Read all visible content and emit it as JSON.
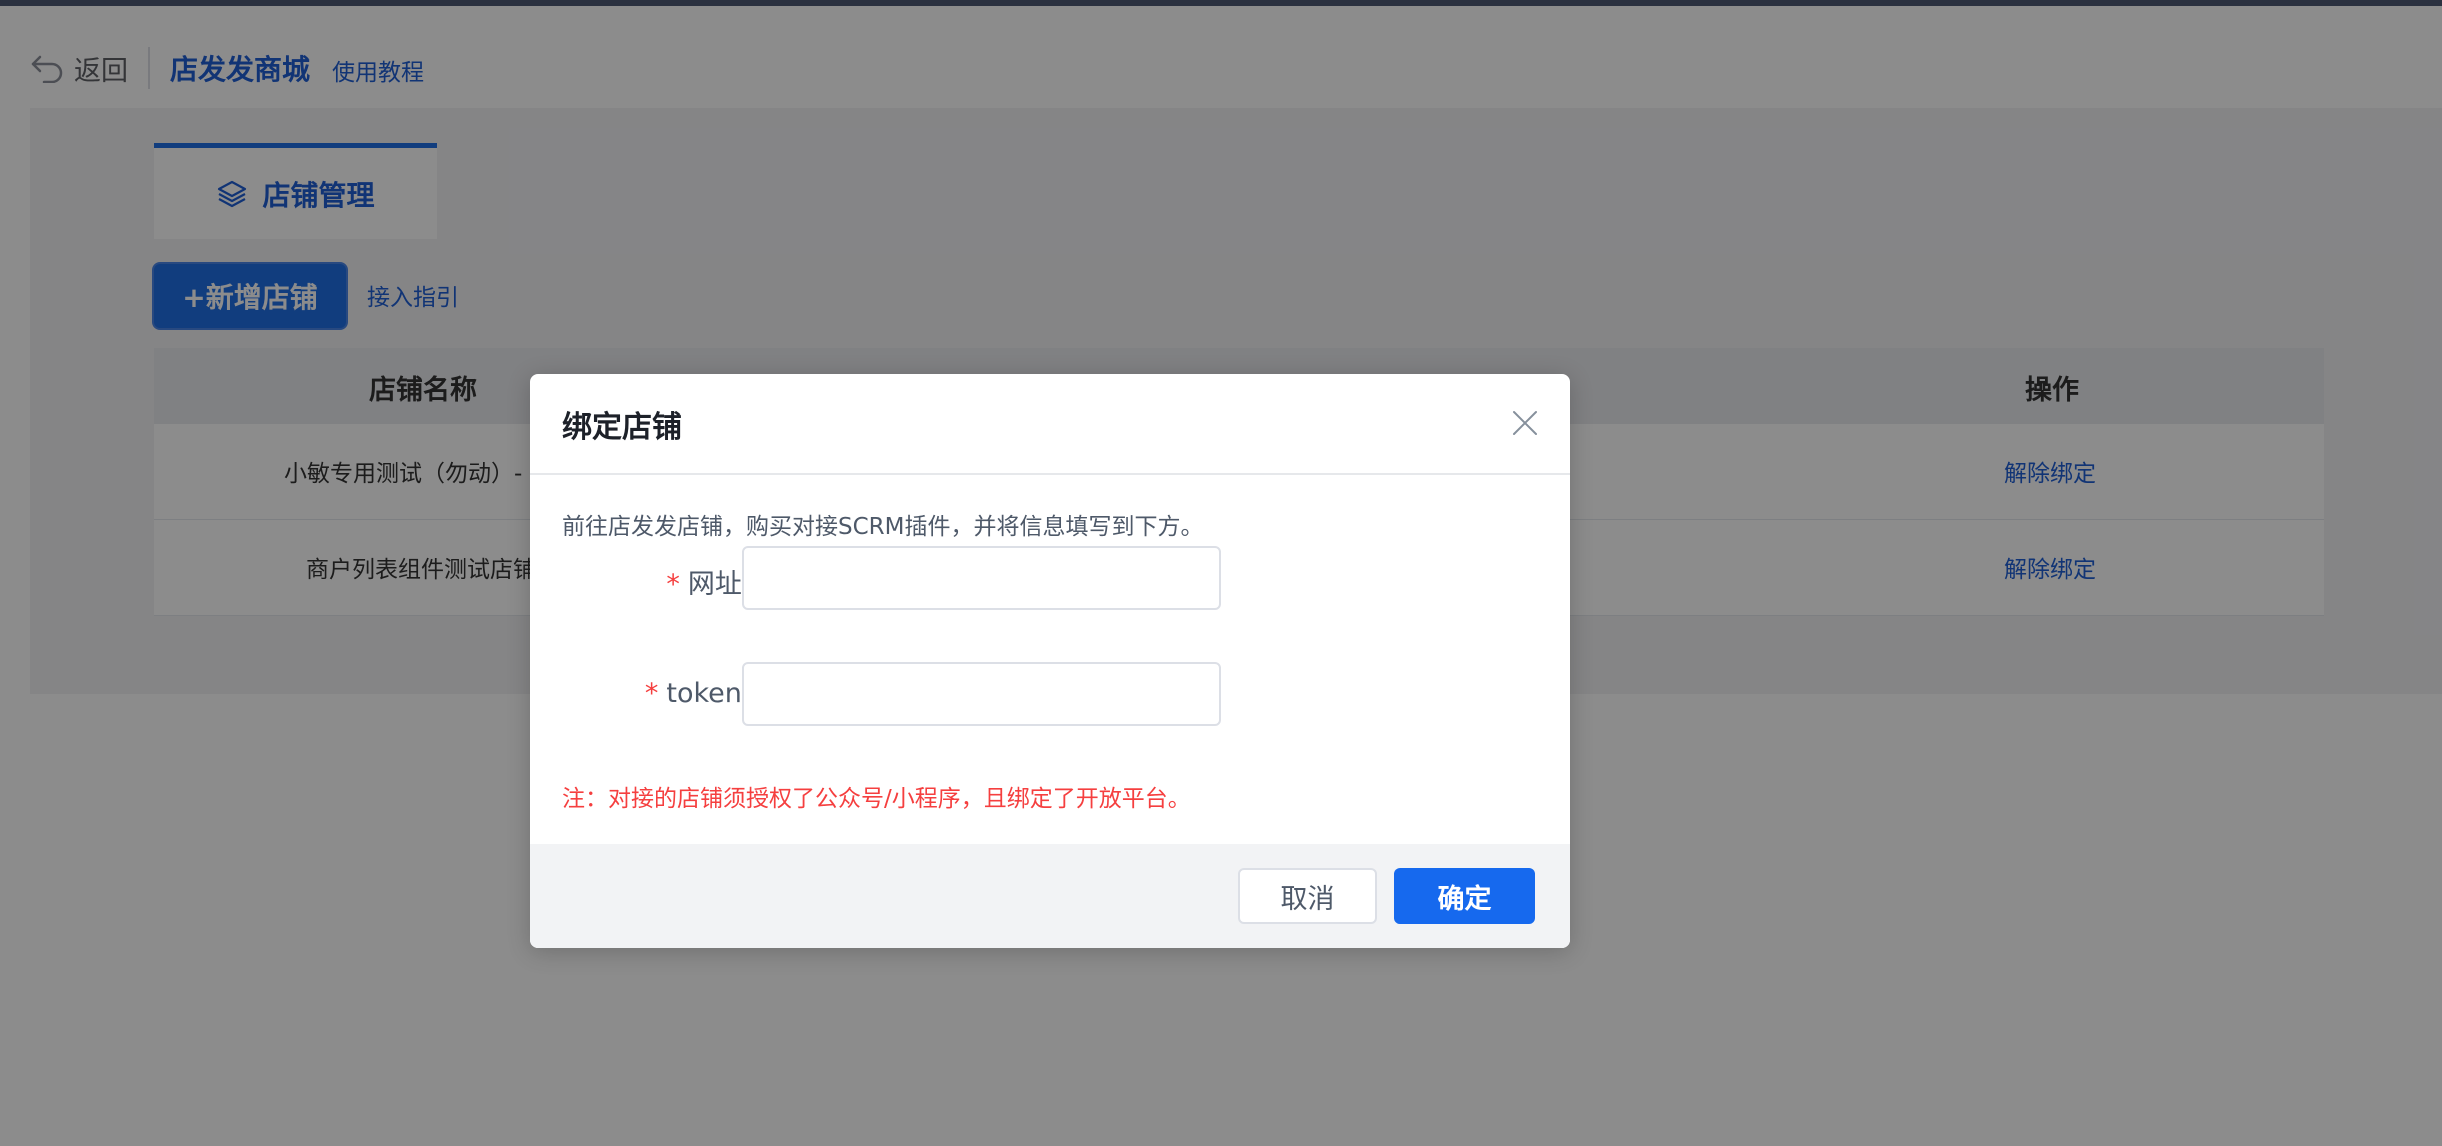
{
  "header": {
    "back_label": "返回",
    "title": "店发发商城",
    "tutorial_link": "使用教程"
  },
  "tabs": [
    {
      "label": "店铺管理",
      "icon": "layers-icon"
    }
  ],
  "toolbar": {
    "add_store_label": "+新增店铺",
    "guide_link": "接入指引"
  },
  "table": {
    "columns": [
      "店铺名称",
      "操作"
    ],
    "rows": [
      {
        "name": "小敏专用测试（勿动）-",
        "action": "解除绑定"
      },
      {
        "name": "商户列表组件测试店铺",
        "action": "解除绑定"
      }
    ]
  },
  "dialog": {
    "title": "绑定店铺",
    "tip": "前往店发发店铺，购买对接SCRM插件，并将信息填写到下方。",
    "fields": [
      {
        "label": "网址:",
        "value": "",
        "placeholder": ""
      },
      {
        "label": "token:",
        "value": "",
        "placeholder": ""
      }
    ],
    "required_mark": "*",
    "note": "注：对接的店铺须授权了公众号/小程序，且绑定了开放平台。",
    "cancel_label": "取消",
    "confirm_label": "确定"
  },
  "colors": {
    "primary": "#1669ee",
    "link": "#1f5fd6",
    "danger": "#f53f3f",
    "overlay": "rgba(0,0,0,0.45)"
  }
}
